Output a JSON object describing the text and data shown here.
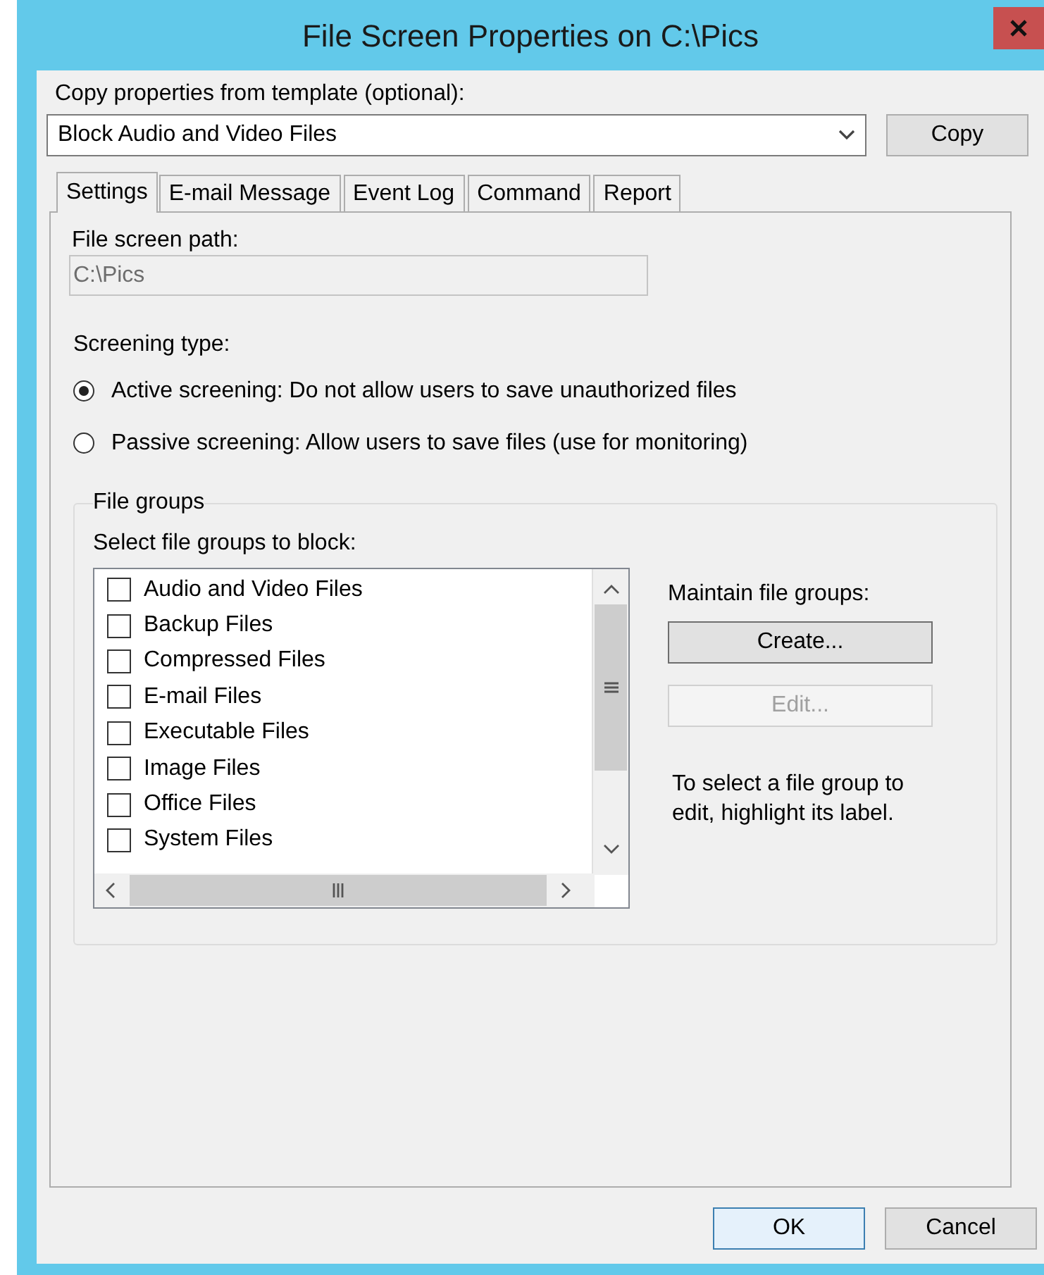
{
  "window": {
    "title": "File Screen Properties on C:\\Pics"
  },
  "template": {
    "label": "Copy properties from template (optional):",
    "value": "Block Audio and Video Files",
    "button": "Copy"
  },
  "tabs": [
    {
      "label": "Settings",
      "selected": true
    },
    {
      "label": "E-mail Message",
      "selected": false
    },
    {
      "label": "Event Log",
      "selected": false
    },
    {
      "label": "Command",
      "selected": false
    },
    {
      "label": "Report",
      "selected": false
    }
  ],
  "settings": {
    "path_label": "File screen path:",
    "path_value": "C:\\Pics",
    "path_disabled": true,
    "screening_label": "Screening type:",
    "screening_options": [
      {
        "label": "Active screening: Do not allow users to save unauthorized files",
        "selected": true
      },
      {
        "label": "Passive screening: Allow users to save files (use for monitoring)",
        "selected": false
      }
    ],
    "file_groups": {
      "legend": "File groups",
      "list_label": "Select file groups to block:",
      "items": [
        {
          "label": "Audio and Video Files",
          "checked": false
        },
        {
          "label": "Backup Files",
          "checked": false
        },
        {
          "label": "Compressed Files",
          "checked": false
        },
        {
          "label": "E-mail Files",
          "checked": false
        },
        {
          "label": "Executable Files",
          "checked": false
        },
        {
          "label": "Image Files",
          "checked": false
        },
        {
          "label": "Office Files",
          "checked": false
        },
        {
          "label": "System Files",
          "checked": false
        }
      ],
      "maintain_label": "Maintain file groups:",
      "buttons": [
        {
          "label": "Create...",
          "disabled": false
        },
        {
          "label": "Edit...",
          "disabled": true
        }
      ],
      "hint": "To select a file group to edit, highlight its label."
    }
  },
  "buttons": [
    {
      "label": "OK",
      "default": true
    },
    {
      "label": "Cancel",
      "default": false
    }
  ]
}
